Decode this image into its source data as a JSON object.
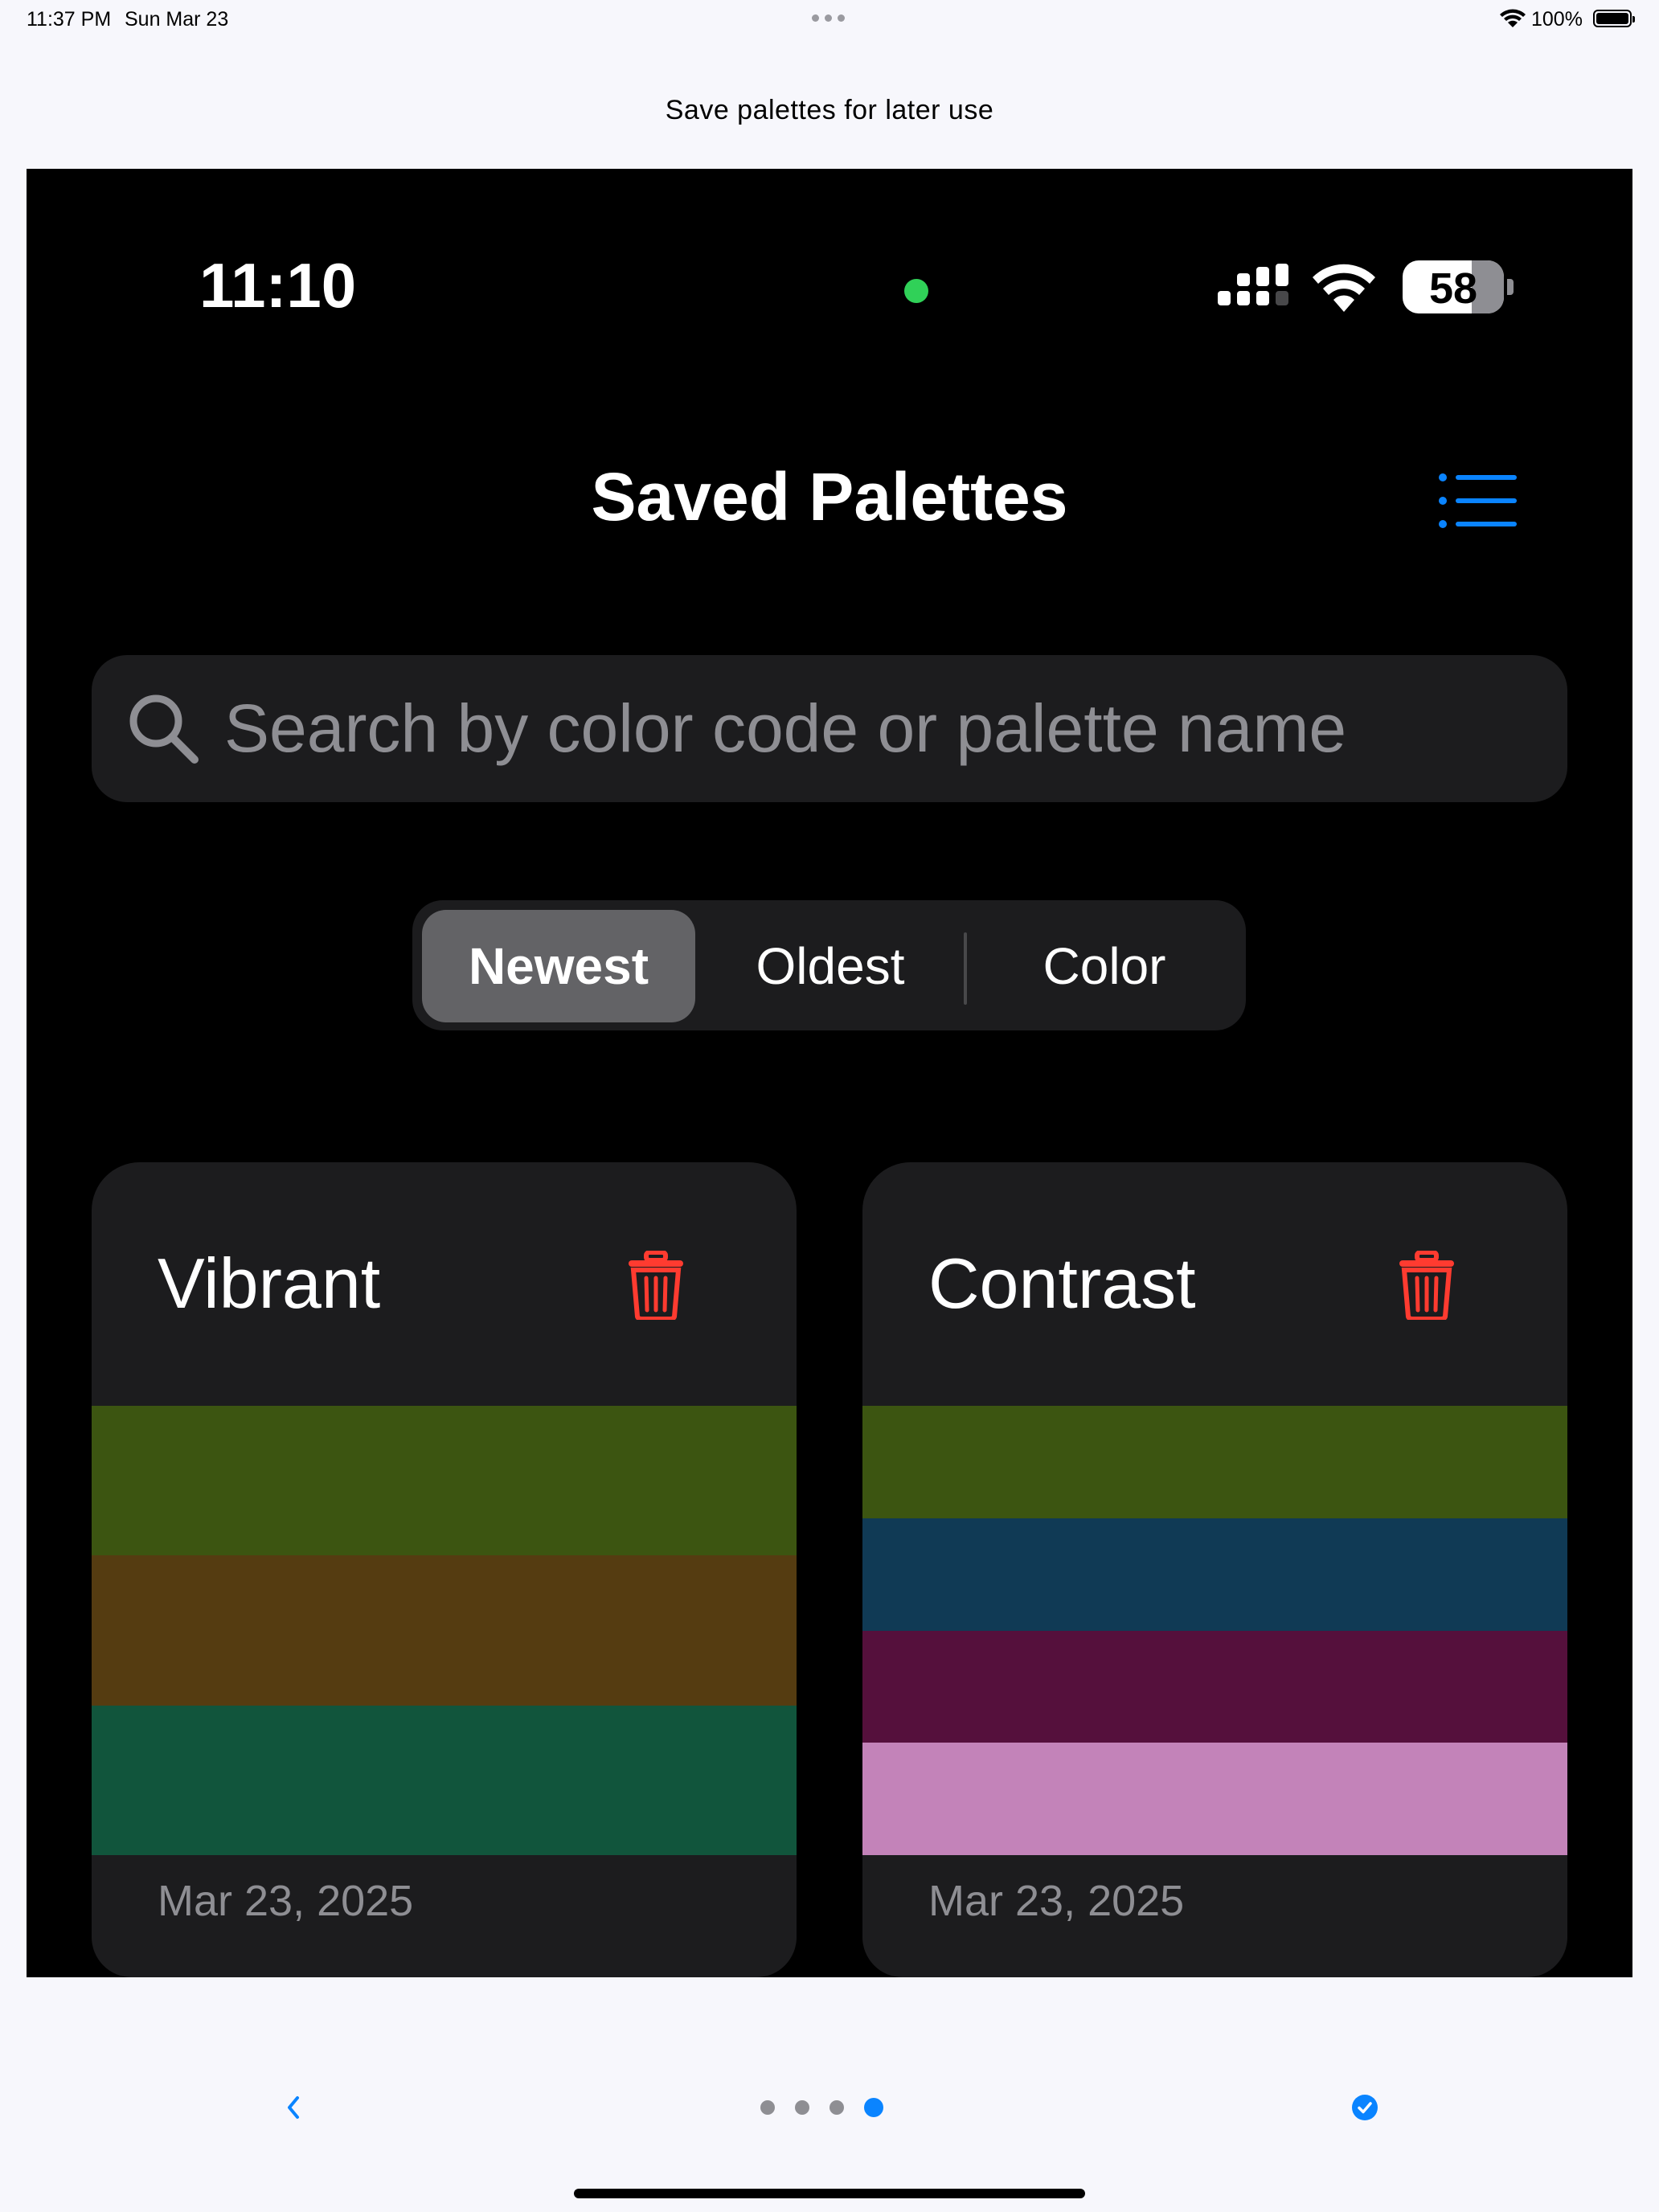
{
  "device_status": {
    "time": "11:37 PM",
    "date": "Sun Mar 23",
    "battery": "100%"
  },
  "caption": "Save palettes for later use",
  "phone": {
    "status": {
      "time": "11:10",
      "battery": "58"
    },
    "title": "Saved Palettes",
    "search": {
      "placeholder": "Search by color code or palette name",
      "value": ""
    },
    "sort": {
      "options": [
        "Newest",
        "Oldest",
        "Color"
      ],
      "selected": "Newest"
    },
    "palettes": [
      {
        "name": "Vibrant",
        "date": "Mar 23, 2025",
        "colors": [
          "#3c5511",
          "#553c11",
          "#11553c"
        ]
      },
      {
        "name": "Contrast",
        "date": "Mar 23, 2025",
        "colors": [
          "#3c5511",
          "#103a55",
          "#55103c",
          "#c383b9"
        ]
      }
    ],
    "colors": {
      "accent": "#0a84ff",
      "delete": "#ff3b30",
      "card": "#1c1c1e"
    }
  },
  "pager": {
    "total": 4,
    "current": 4
  }
}
